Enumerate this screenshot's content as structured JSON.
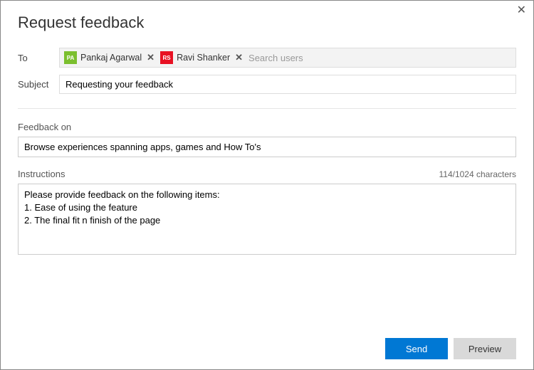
{
  "title": "Request feedback",
  "labels": {
    "to": "To",
    "subject": "Subject",
    "feedback_on": "Feedback on",
    "instructions": "Instructions"
  },
  "to": {
    "recipients": [
      {
        "initials": "PA",
        "name": "Pankaj Agarwal",
        "color": "green"
      },
      {
        "initials": "RS",
        "name": "Ravi Shanker",
        "color": "red"
      }
    ],
    "placeholder": "Search users"
  },
  "subject": {
    "value": "Requesting your feedback"
  },
  "feedback_on": {
    "value": "Browse experiences spanning apps, games and How To's"
  },
  "instructions": {
    "value": "Please provide feedback on the following items:\n1. Ease of using the feature\n2. The final fit n finish of the page",
    "char_count": "114/1024 characters"
  },
  "buttons": {
    "send": "Send",
    "preview": "Preview"
  }
}
